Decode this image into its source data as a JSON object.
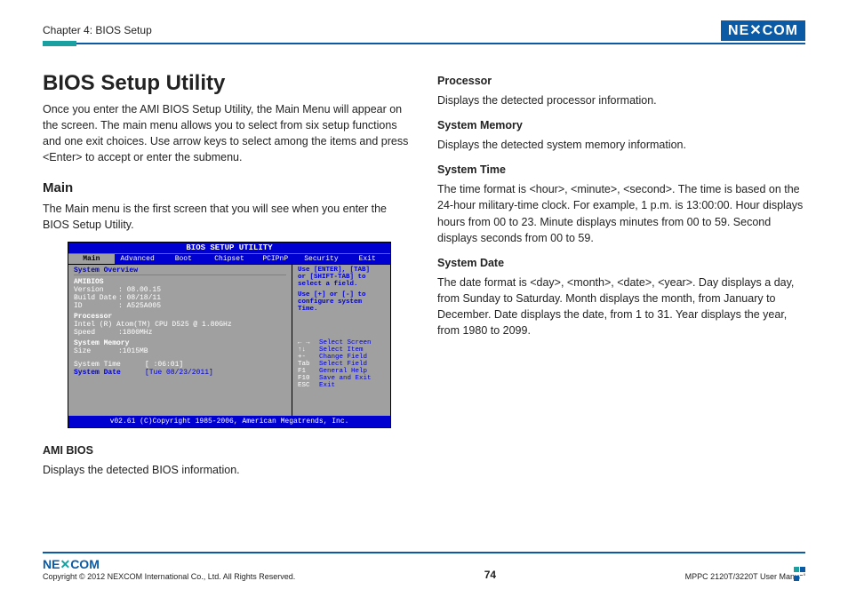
{
  "header": {
    "chapter": "Chapter 4: BIOS Setup",
    "logo_text": "NE COM"
  },
  "left": {
    "title": "BIOS Setup Utility",
    "intro": "Once you enter the AMI BIOS Setup Utility, the Main Menu will appear on the screen. The main menu allows you to select from six setup functions and one exit choices. Use arrow keys to select among the items and press <Enter> to accept or enter the submenu.",
    "main_head": "Main",
    "main_para": "The Main menu is the first screen that you will see when you enter the BIOS Setup Utility.",
    "amibios_head": "AMI BIOS",
    "amibios_para": "Displays the detected BIOS information."
  },
  "right": {
    "proc_head": "Processor",
    "proc_para": "Displays the detected processor information.",
    "mem_head": "System Memory",
    "mem_para": "Displays the detected system memory information.",
    "time_head": "System Time",
    "time_para": "The time format is <hour>, <minute>, <second>. The time is based on the 24-hour military-time clock. For example, 1 p.m. is 13:00:00. Hour displays hours from 00 to 23. Minute displays minutes from 00 to 59. Second displays seconds from 00 to 59.",
    "date_head": "System Date",
    "date_para": "The date format is <day>, <month>, <date>, <year>. Day displays a day, from Sunday to Saturday. Month displays the month, from January to December. Date displays the date, from 1 to 31. Year displays the year, from 1980 to 2099."
  },
  "bios": {
    "title": "BIOS SETUP UTILITY",
    "tabs": [
      "Main",
      "Advanced",
      "Boot",
      "Chipset",
      "PCIPnP",
      "Security",
      "Exit"
    ],
    "overview": "System Overview",
    "amibios": "AMIBIOS",
    "version_k": "Version",
    "version_v": ": 08.00.15",
    "build_k": "Build Date",
    "build_v": ": 08/18/11",
    "id_k": "ID",
    "id_v": ": A525A005",
    "processor_h": "Processor",
    "processor_v": "Intel (R) Atom(TM) CPU D525 @ 1.80GHz",
    "speed_k": "Speed",
    "speed_v": ":1800MHz",
    "sysmem_h": "System Memory",
    "size_k": "Size",
    "size_v": ":1015MB",
    "systime_k": "System Time",
    "systime_v": "[ :06:01]",
    "sysdate_k": "System Date",
    "sysdate_v": "[Tue 08/23/2011]",
    "hint1a": "Use [ENTER], [TAB]",
    "hint1b": "or [SHIFT-TAB] to",
    "hint1c": "select a field.",
    "hint2a": "Use [+] or [-] to",
    "hint2b": "configure system Time.",
    "nav": [
      {
        "k": "← →",
        "v": "Select Screen"
      },
      {
        "k": "↑↓",
        "v": "Select Item"
      },
      {
        "k": "+-",
        "v": "Change Field"
      },
      {
        "k": "Tab",
        "v": "Select Field"
      },
      {
        "k": "F1",
        "v": "General Help"
      },
      {
        "k": "F10",
        "v": "Save and Exit"
      },
      {
        "k": "ESC",
        "v": "Exit"
      }
    ],
    "footer": "v02.61 (C)Copyright 1985-2006, American Megatrends, Inc."
  },
  "footer": {
    "logo": "NEXCOM",
    "copyright": "Copyright © 2012 NEXCOM International Co., Ltd. All Rights Reserved.",
    "page": "74",
    "manual": "MPPC 2120T/3220T User Manual"
  }
}
